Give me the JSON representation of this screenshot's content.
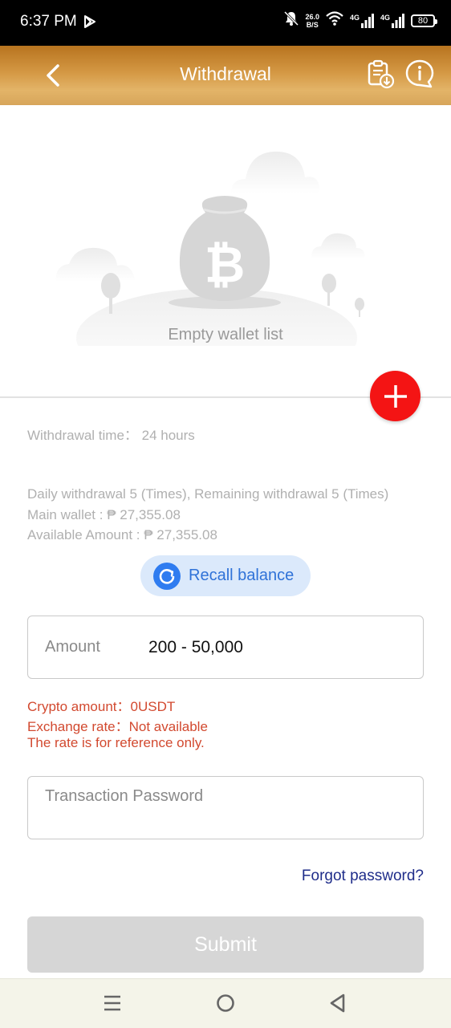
{
  "status_bar": {
    "time": "6:37 PM",
    "net_speed_value": "26.0",
    "net_speed_unit": "B/S",
    "signal1_label": "4G",
    "signal2_label": "4G",
    "battery": "80",
    "icons": [
      "play-icon",
      "mute-bell-icon",
      "wifi-icon",
      "signal-icon",
      "battery-icon"
    ]
  },
  "header": {
    "title": "Withdrawal",
    "icons": [
      "back-chevron-icon",
      "clipboard-download-icon",
      "info-bubble-icon"
    ]
  },
  "wallet": {
    "empty_text": "Empty wallet list",
    "add_icon": "plus-icon"
  },
  "info": {
    "withdrawal_time": "Withdrawal time：  24 hours",
    "daily_limit": "Daily withdrawal 5 (Times), Remaining withdrawal 5 (Times)",
    "main_wallet": "Main wallet : ₱ 27,355.08",
    "available_amount": "Available Amount : ₱ 27,355.08"
  },
  "recall": {
    "label": "Recall balance",
    "icon": "refresh-icon"
  },
  "amount": {
    "label": "Amount",
    "placeholder": "200 - 50,000"
  },
  "crypto": {
    "amount": "Crypto amount：0USDT",
    "exchange_rate": "Exchange rate：Not available",
    "note": "The rate is for reference only."
  },
  "password": {
    "placeholder": "Transaction Password"
  },
  "forgot_password": "Forgot password?",
  "submit": "Submit",
  "colors": {
    "header_gradient": [
      "#b8741f",
      "#e3b468"
    ],
    "add_button": "#f41414",
    "recall_bg": "#dbe9fb",
    "recall_accent": "#2f7cf0",
    "warning_text": "#d2492f",
    "link": "#1f2d8a",
    "submit_disabled": "#d6d6d6"
  },
  "nav": {
    "icons": [
      "menu-icon",
      "home-circle-icon",
      "back-triangle-icon"
    ]
  }
}
